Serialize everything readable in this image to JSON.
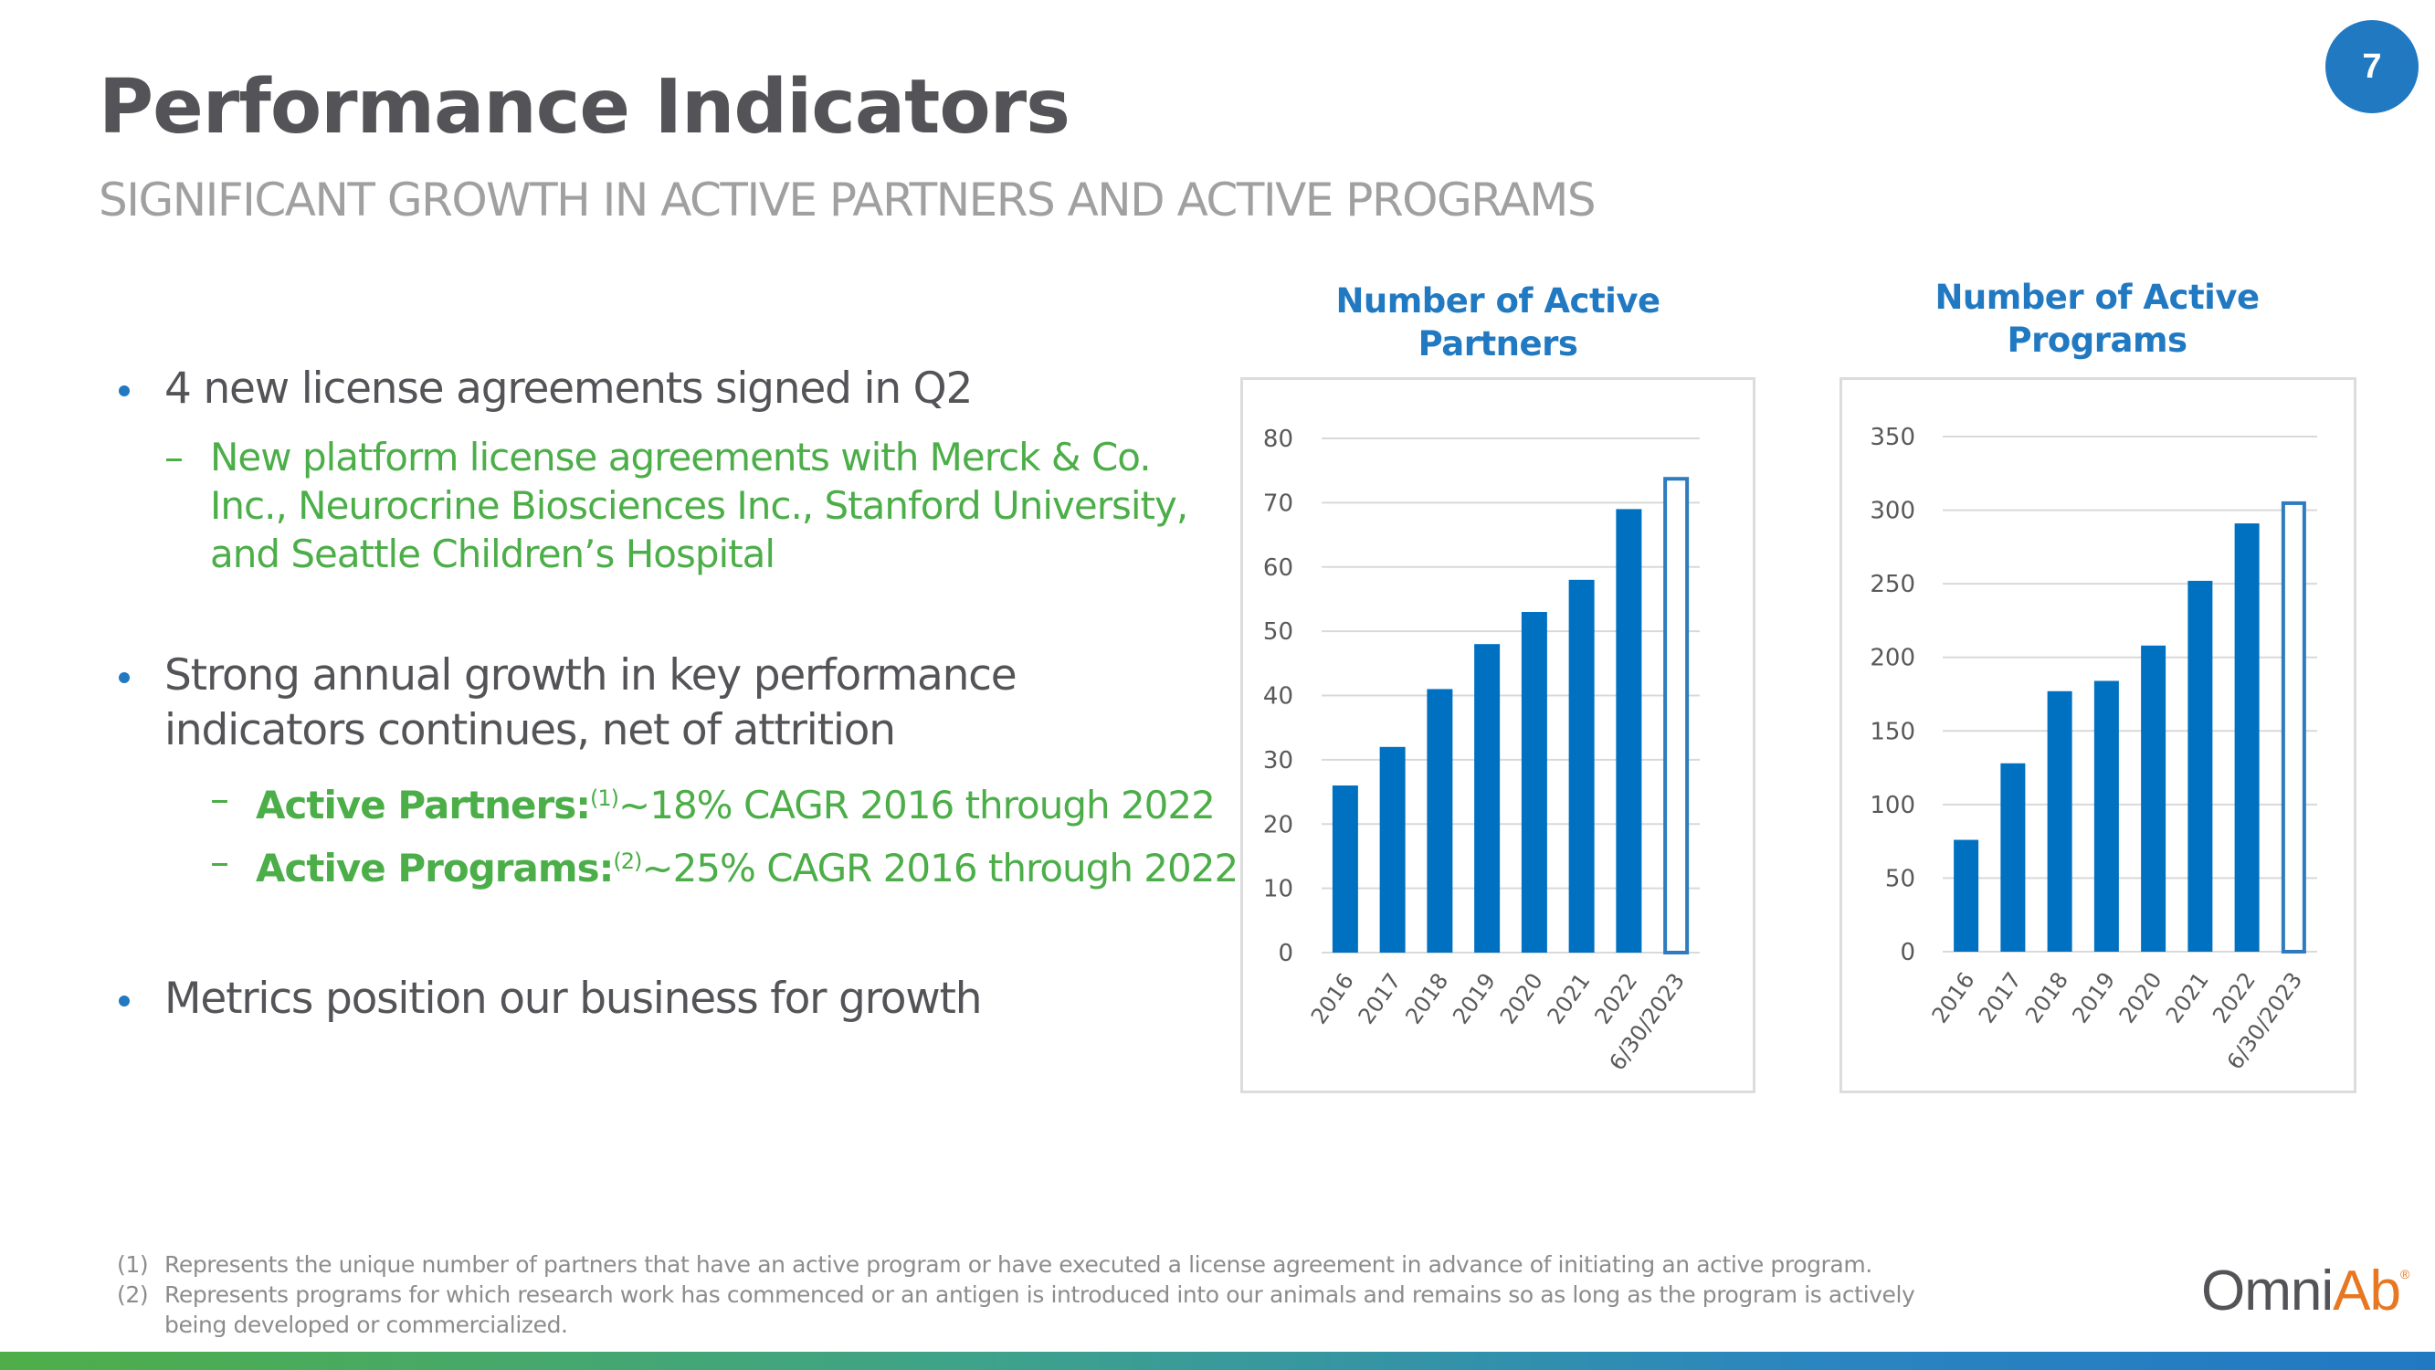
{
  "header": {
    "title": "Performance Indicators",
    "subtitle": "SIGNIFICANT GROWTH IN ACTIVE PARTNERS AND ACTIVE PROGRAMS",
    "page_number": "7"
  },
  "bullets": [
    {
      "text": "4 new license agreements signed in Q2",
      "sub": [
        {
          "lines": [
            "New platform license agreements with Merck & Co.",
            "Inc., Neurocrine Biosciences Inc., Stanford University,",
            "and Seattle Children’s Hospital"
          ]
        }
      ]
    },
    {
      "lines": [
        "Strong annual growth in key performance",
        "indicators continues, net of attrition"
      ],
      "sub": [
        {
          "label": "Active Partners:",
          "ref": "(1)",
          "text": "~18% CAGR 2016 through 2022"
        },
        {
          "label": "Active Programs:",
          "ref": "(2)",
          "text": "~25% CAGR 2016 through 2022"
        }
      ]
    },
    {
      "text": "Metrics position our business for growth"
    }
  ],
  "dash": "–",
  "footnotes": [
    {
      "num": "(1)",
      "lines": [
        "Represents the unique number of partners that have an active program or have executed a license agreement in advance of initiating an active program."
      ]
    },
    {
      "num": "(2)",
      "lines": [
        "Represents programs for which research work has commenced or an antigen is introduced into our animals and remains so as long as the program is actively",
        "being developed or commercialized."
      ]
    }
  ],
  "logo": {
    "part1": "Omni",
    "part2": "Ab",
    "reg": "®"
  },
  "colors": {
    "bar": "#0070c0",
    "outline_bar": "#2e7bbf",
    "accent": "#2179c2",
    "green": "#4cae48",
    "grid": "#d9d9d9"
  },
  "chart_data": [
    {
      "type": "bar",
      "title": "Number of Active Partners",
      "title_lines": [
        "Number of Active",
        "Partners"
      ],
      "categories": [
        "2016",
        "2017",
        "2018",
        "2019",
        "2020",
        "2021",
        "2022",
        "6/30/2023"
      ],
      "values": [
        26,
        32,
        41,
        48,
        53,
        58,
        69,
        74
      ],
      "outlined": [
        false,
        false,
        false,
        false,
        false,
        false,
        false,
        true
      ],
      "xlabel": "",
      "ylabel": "",
      "ylim": [
        0,
        80
      ],
      "yticks": [
        0,
        10,
        20,
        30,
        40,
        50,
        60,
        70,
        80
      ],
      "grid": true,
      "legend": "none"
    },
    {
      "type": "bar",
      "title": "Number of Active Programs",
      "title_lines": [
        "Number of Active",
        "Programs"
      ],
      "categories": [
        "2016",
        "2017",
        "2018",
        "2019",
        "2020",
        "2021",
        "2022",
        "6/30/2023"
      ],
      "values": [
        76,
        128,
        177,
        184,
        208,
        252,
        291,
        306
      ],
      "outlined": [
        false,
        false,
        false,
        false,
        false,
        false,
        false,
        true
      ],
      "xlabel": "",
      "ylabel": "",
      "ylim": [
        0,
        350
      ],
      "yticks": [
        0,
        50,
        100,
        150,
        200,
        250,
        300,
        350
      ],
      "grid": true,
      "legend": "none"
    }
  ]
}
